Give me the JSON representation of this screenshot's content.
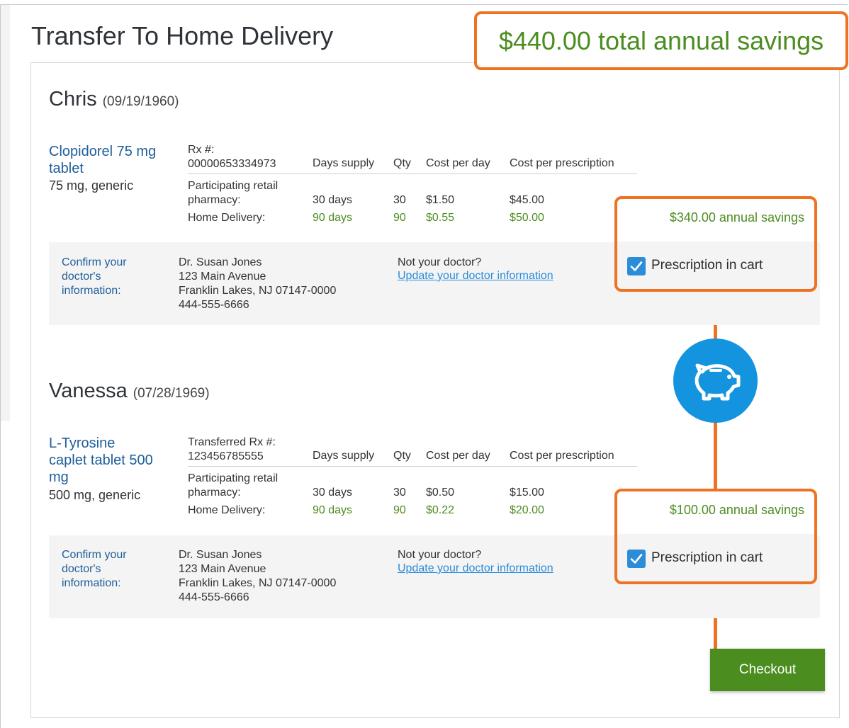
{
  "page": {
    "title": "Transfer To Home Delivery",
    "total_savings": "$440.00 total annual savings"
  },
  "columns": {
    "days_supply": "Days supply",
    "qty": "Qty",
    "cost_per_day": "Cost per day",
    "cost_per_prescription": "Cost per prescription"
  },
  "patients": [
    {
      "name": "Chris",
      "dob": "(09/19/1960)",
      "medication": {
        "name_line1": "Clopidorel 75 mg",
        "name_line2": "tablet",
        "name_line3": "",
        "detail": "75 mg, generic"
      },
      "rx_label": "Rx #:",
      "rx_number": "00000653334973",
      "retail": {
        "label_line1": "Participating retail",
        "label_line2": "pharmacy:",
        "days": "30 days",
        "qty": "30",
        "cost_per_day": "$1.50",
        "cost_per_rx": "$45.00"
      },
      "home": {
        "label": "Home Delivery:",
        "days": "90 days",
        "qty": "90",
        "cost_per_day": "$0.55",
        "cost_per_rx": "$50.00"
      },
      "annual_savings": "$340.00 annual savings",
      "doctor": {
        "confirm_line1": "Confirm your",
        "confirm_line2": "doctor's",
        "confirm_line3": "information:",
        "name": "Dr. Susan Jones",
        "street": "123 Main Avenue",
        "city": "Franklin Lakes, NJ 07147-0000",
        "phone": "444-555-6666",
        "not_your_doctor": "Not your doctor?",
        "update_link": "Update your doctor information"
      },
      "in_cart_label": "Prescription in cart"
    },
    {
      "name": "Vanessa",
      "dob": "(07/28/1969)",
      "medication": {
        "name_line1": "L-Tyrosine",
        "name_line2": "caplet tablet 500",
        "name_line3": "mg",
        "detail": "500 mg, generic"
      },
      "rx_label": "Transferred Rx #:",
      "rx_number": "123456785555",
      "retail": {
        "label_line1": "Participating retail",
        "label_line2": "pharmacy:",
        "days": "30 days",
        "qty": "30",
        "cost_per_day": "$0.50",
        "cost_per_rx": "$15.00"
      },
      "home": {
        "label": "Home Delivery:",
        "days": "90 days",
        "qty": "90",
        "cost_per_day": "$0.22",
        "cost_per_rx": "$20.00"
      },
      "annual_savings": "$100.00 annual savings",
      "doctor": {
        "confirm_line1": "Confirm your",
        "confirm_line2": "doctor's",
        "confirm_line3": "information:",
        "name": "Dr. Susan Jones",
        "street": "123 Main Avenue",
        "city": "Franklin Lakes, NJ 07147-0000",
        "phone": "444-555-6666",
        "not_your_doctor": "Not your doctor?",
        "update_link": "Update your doctor information"
      },
      "in_cart_label": "Prescription in cart"
    }
  ],
  "checkout_label": "Checkout",
  "icons": {
    "savings": "piggy-bank-icon",
    "checkbox": "checkmark-icon"
  },
  "colors": {
    "accent_orange": "#ee7221",
    "savings_green": "#4b8d1f",
    "link_blue": "#2b8cd8",
    "piggy_blue": "#1493de",
    "checkout_green": "#4b8d1f"
  }
}
